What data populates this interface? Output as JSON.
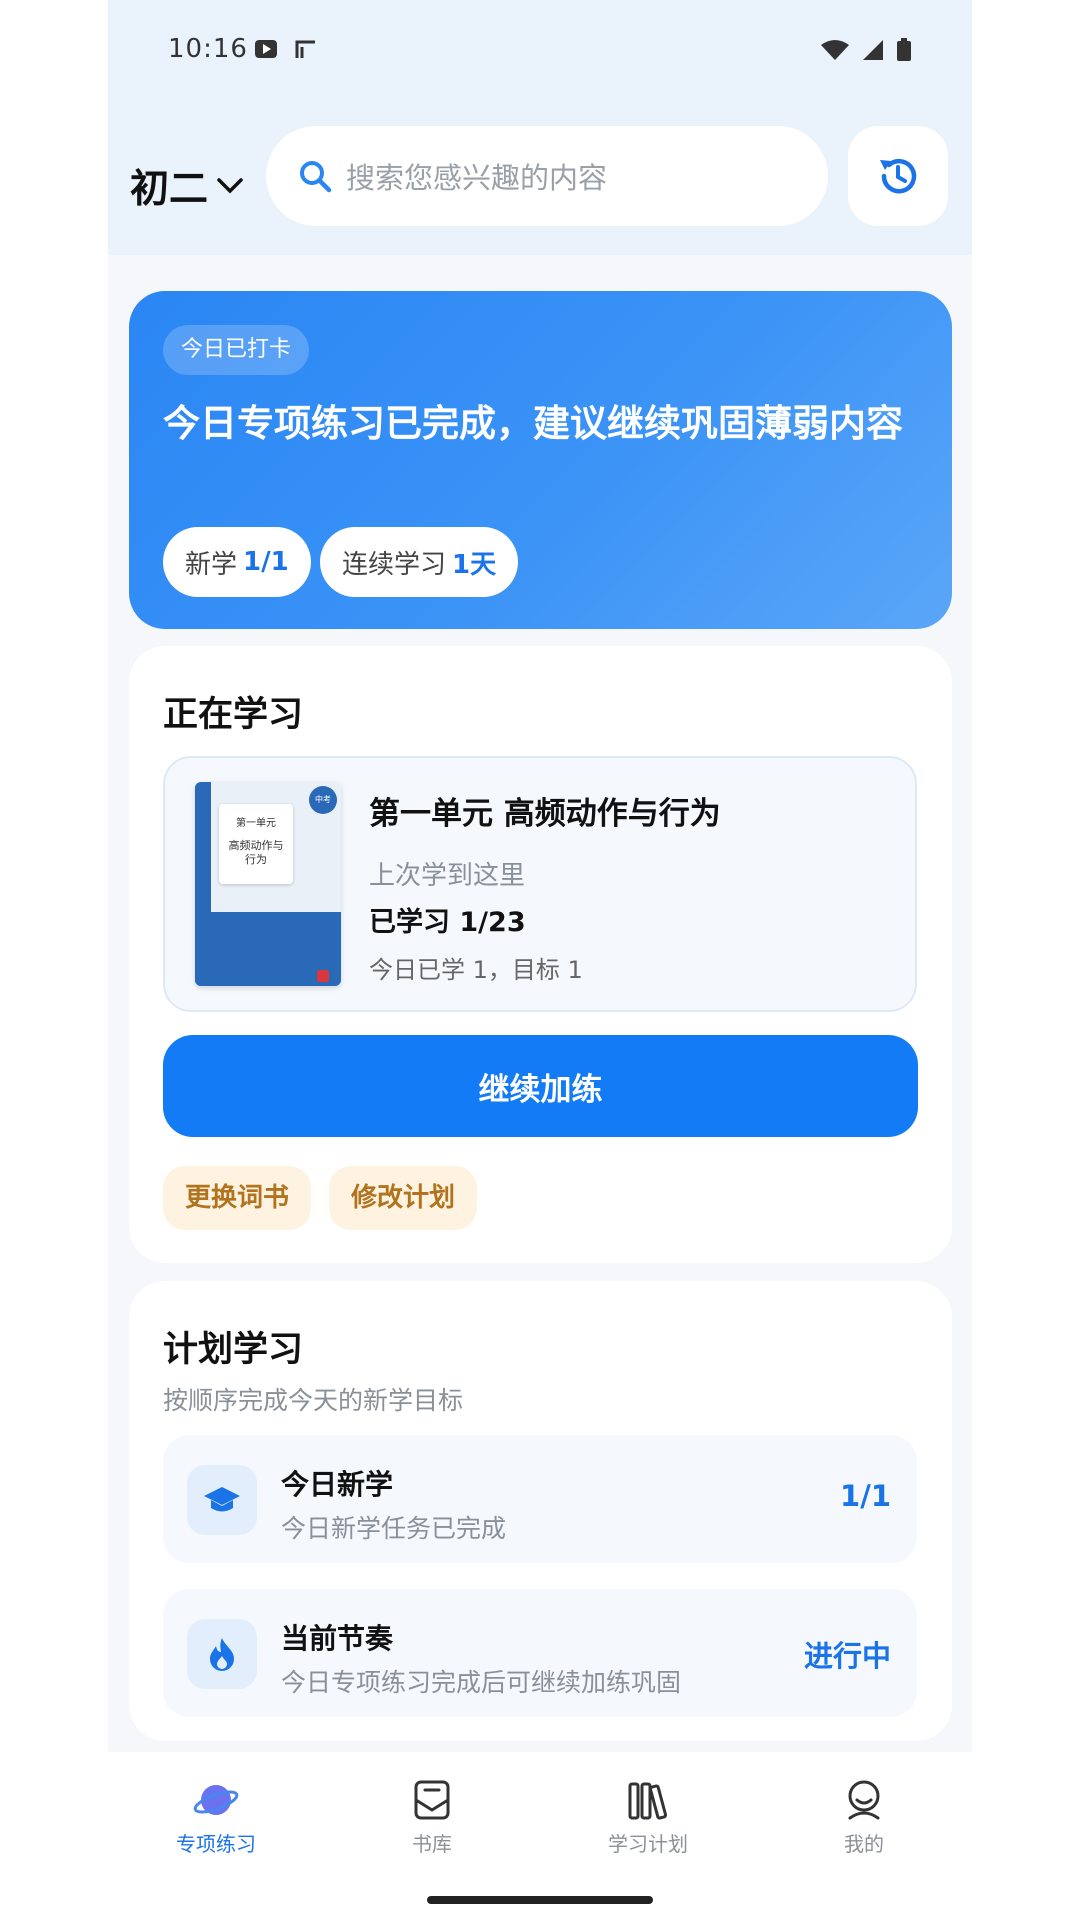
{
  "status_bar": {
    "time": "10:16"
  },
  "header": {
    "grade": "初二",
    "search_placeholder": "搜索您感兴趣的内容"
  },
  "banner": {
    "tag": "今日已打卡",
    "title": "今日专项练习已完成，建议继续巩固薄弱内容",
    "chips": [
      {
        "label": "新学",
        "value": "1/1"
      },
      {
        "label": "连续学习",
        "value": "1天"
      }
    ]
  },
  "learning": {
    "title": "正在学习",
    "book": {
      "cover_title": "第一单元",
      "cover_subtitle": "高频动作与行为",
      "cover_badge": "中考",
      "name": "第一单元 高频动作与行为",
      "last_position": "上次学到这里",
      "progress": "已学习 1/23",
      "today": "今日已学 1，目标 1"
    },
    "continue_label": "继续加练",
    "change_book_label": "更换词书",
    "edit_plan_label": "修改计划"
  },
  "plan": {
    "title": "计划学习",
    "subtitle": "按顺序完成今天的新学目标",
    "items": [
      {
        "icon": "graduation-cap-icon",
        "name": "今日新学",
        "desc": "今日新学任务已完成",
        "status": "1/1"
      },
      {
        "icon": "flame-icon",
        "name": "当前节奏",
        "desc": "今日专项练习完成后可继续加练巩固",
        "status": "进行中"
      }
    ]
  },
  "bottom_nav": {
    "items": [
      {
        "label": "专项练习",
        "icon": "planet-icon",
        "active": true
      },
      {
        "label": "书库",
        "icon": "book-box-icon",
        "active": false
      },
      {
        "label": "学习计划",
        "icon": "books-icon",
        "active": false
      },
      {
        "label": "我的",
        "icon": "user-icon",
        "active": false
      }
    ]
  },
  "colors": {
    "primary": "#127bf5",
    "accent_text": "#1b73e8",
    "warm_button_bg": "#fdf3e0",
    "warm_button_text": "#b2731e"
  }
}
